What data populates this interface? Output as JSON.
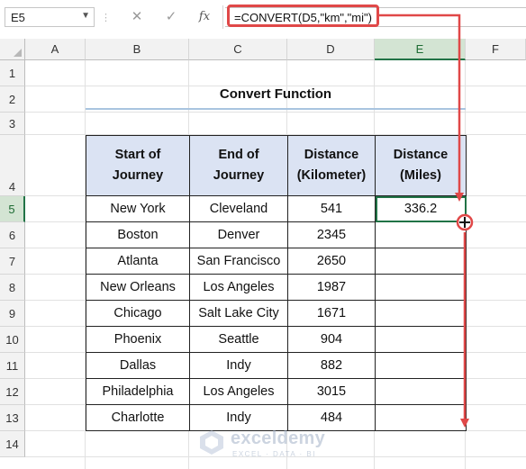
{
  "formula_bar": {
    "name_box": "E5",
    "cancel_icon": "✕",
    "enter_icon": "✓",
    "function_icon": "fx",
    "formula": "=CONVERT(D5,\"km\",\"mi\")"
  },
  "columns": [
    "A",
    "B",
    "C",
    "D",
    "E",
    "F"
  ],
  "rows": [
    "1",
    "2",
    "3",
    "4",
    "5",
    "6",
    "7",
    "8",
    "9",
    "10",
    "11",
    "12",
    "13",
    "14"
  ],
  "selected": {
    "column": "E",
    "row": "5"
  },
  "title": "Convert Function",
  "table": {
    "headers": [
      [
        "Start of",
        "Journey"
      ],
      [
        "End of",
        "Journey"
      ],
      [
        "Distance",
        "(Kilometer)"
      ],
      [
        "Distance",
        "(Miles)"
      ]
    ],
    "rows": [
      {
        "start": "New York",
        "end": "Cleveland",
        "km": "541",
        "mi": "336.2"
      },
      {
        "start": "Boston",
        "end": "Denver",
        "km": "2345",
        "mi": ""
      },
      {
        "start": "Atlanta",
        "end": "San Francisco",
        "km": "2650",
        "mi": ""
      },
      {
        "start": "New Orleans",
        "end": "Los Angeles",
        "km": "1987",
        "mi": ""
      },
      {
        "start": "Chicago",
        "end": "Salt Lake City",
        "km": "1671",
        "mi": ""
      },
      {
        "start": "Phoenix",
        "end": "Seattle",
        "km": "904",
        "mi": ""
      },
      {
        "start": "Dallas",
        "end": "Indy",
        "km": "882",
        "mi": ""
      },
      {
        "start": "Philadelphia",
        "end": "Los Angeles",
        "km": "3015",
        "mi": ""
      },
      {
        "start": "Charlotte",
        "end": "Indy",
        "km": "484",
        "mi": ""
      }
    ]
  },
  "watermark": {
    "name": "exceldemy",
    "tagline": "EXCEL · DATA · BI"
  },
  "colors": {
    "annotation": "#e04848",
    "selection": "#217346",
    "header_fill": "#dbe3f3"
  }
}
